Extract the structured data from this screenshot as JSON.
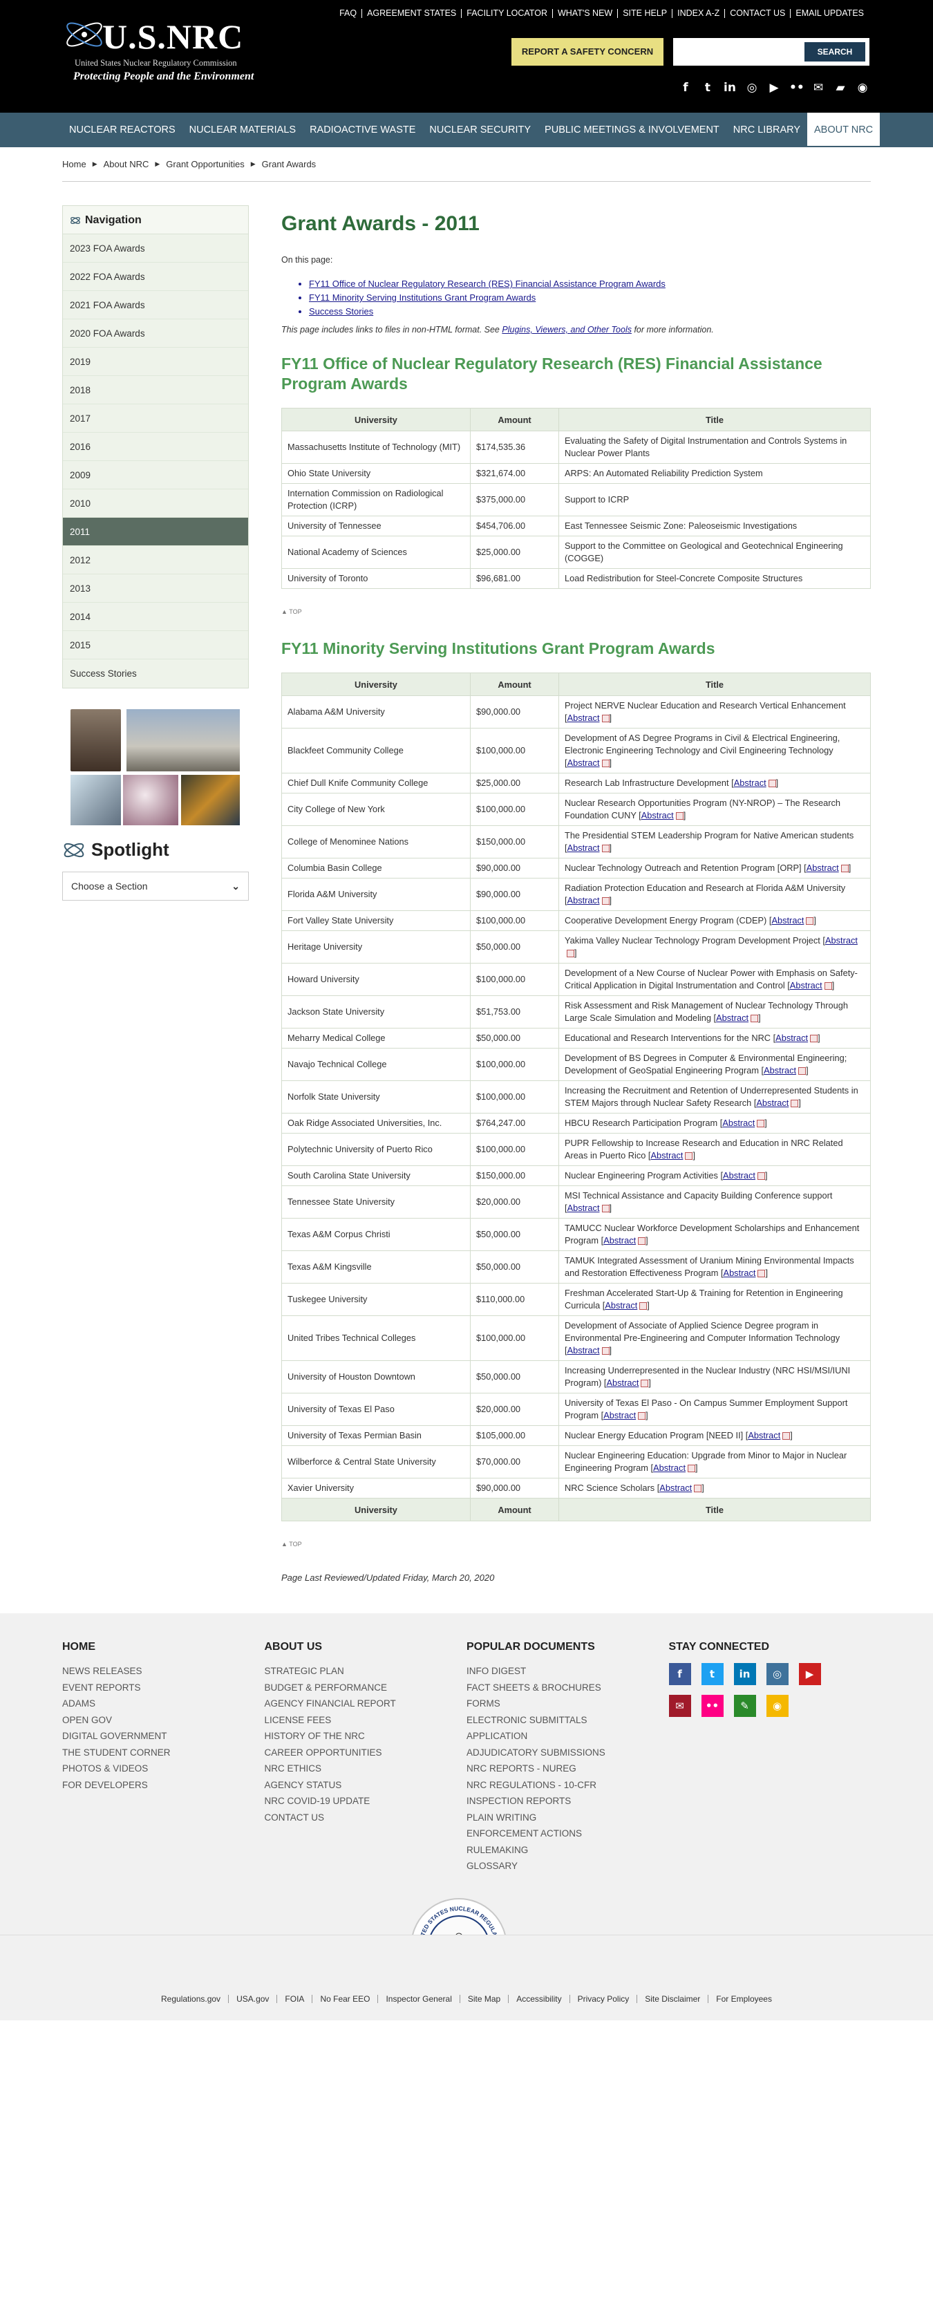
{
  "header": {
    "logo_title": "U.S.NRC",
    "logo_subtitle": "United States Nuclear Regulatory Commission",
    "logo_tagline": "Protecting People and the Environment",
    "utility_links": [
      "FAQ",
      "AGREEMENT STATES",
      "FACILITY LOCATOR",
      "WHAT'S NEW",
      "SITE HELP",
      "INDEX A-Z",
      "CONTACT US",
      "EMAIL UPDATES"
    ],
    "safety_button": "REPORT A SAFETY CONCERN",
    "search_placeholder": "",
    "search_button": "SEARCH"
  },
  "nav": [
    "NUCLEAR REACTORS",
    "NUCLEAR MATERIALS",
    "RADIOACTIVE WASTE",
    "NUCLEAR SECURITY",
    "PUBLIC MEETINGS & INVOLVEMENT",
    "NRC LIBRARY",
    "ABOUT NRC"
  ],
  "breadcrumb": [
    "Home",
    "About NRC",
    "Grant Opportunities",
    "Grant Awards"
  ],
  "sidebar": {
    "title": "Navigation",
    "items": [
      "2023 FOA Awards",
      "2022 FOA Awards",
      "2021 FOA Awards",
      "2020 FOA Awards",
      "2019",
      "2018",
      "2017",
      "2016",
      "2009",
      "2010",
      "2011",
      "2012",
      "2013",
      "2014",
      "2015",
      "Success Stories"
    ],
    "spotlight": "Spotlight",
    "section_select": "Choose a Section"
  },
  "page": {
    "title": "Grant Awards - 2011",
    "on_this_page": "On this page:",
    "toc": [
      "FY11 Office of Nuclear Regulatory Research (RES) Financial Assistance Program Awards",
      "FY11 Minority Serving Institutions Grant Program Awards",
      "Success Stories"
    ],
    "note_prefix": "This page includes links to files in non-HTML format. See ",
    "note_link": "Plugins, Viewers, and Other Tools",
    "note_suffix": " for more information.",
    "top_label": "TOP",
    "abstract_label": "Abstract",
    "reviewed": "Page Last Reviewed/Updated Friday, March 20, 2020"
  },
  "res_table": {
    "heading": "FY11 Office of Nuclear Regulatory Research (RES) Financial Assistance Program Awards",
    "columns": [
      "University",
      "Amount",
      "Title"
    ],
    "rows": [
      [
        "Massachusetts Institute of Technology (MIT)",
        "$174,535.36",
        "Evaluating the Safety of Digital Instrumentation and Controls Systems in Nuclear Power Plants"
      ],
      [
        "Ohio State University",
        "$321,674.00",
        "ARPS: An Automated Reliability Prediction System"
      ],
      [
        "Internation Commission on Radiological Protection (ICRP)",
        "$375,000.00",
        "Support to ICRP"
      ],
      [
        "University of Tennessee",
        "$454,706.00",
        "East Tennessee Seismic Zone: Paleoseismic Investigations"
      ],
      [
        "National Academy of Sciences",
        "$25,000.00",
        "Support to the Committee on Geological and Geotechnical Engineering (COGGE)"
      ],
      [
        "University of Toronto",
        "$96,681.00",
        "Load Redistribution for Steel-Concrete Composite Structures"
      ]
    ]
  },
  "msi_table": {
    "heading": "FY11 Minority Serving Institutions Grant Program Awards",
    "columns": [
      "University",
      "Amount",
      "Title"
    ],
    "rows": [
      [
        "Alabama A&M University",
        "$90,000.00",
        "Project NERVE Nuclear Education and Research Vertical Enhancement"
      ],
      [
        "Blackfeet Community College",
        "$100,000.00",
        "Development of AS Degree Programs in Civil & Electrical Engineering, Electronic Engineering Technology and Civil Engineering Technology"
      ],
      [
        "Chief Dull Knife Community College",
        "$25,000.00",
        "Research Lab Infrastructure Development"
      ],
      [
        "City College of New York",
        "$100,000.00",
        "Nuclear Research Opportunities Program (NY-NROP) – The Research Foundation CUNY"
      ],
      [
        "College of Menominee Nations",
        "$150,000.00",
        "The Presidential STEM Leadership Program for Native American students"
      ],
      [
        "Columbia Basin College",
        "$90,000.00",
        "Nuclear Technology Outreach and Retention Program [ORP]"
      ],
      [
        "Florida A&M University",
        "$90,000.00",
        "Radiation Protection Education and Research at Florida A&M University"
      ],
      [
        "Fort Valley State University",
        "$100,000.00",
        "Cooperative Development Energy Program (CDEP)"
      ],
      [
        "Heritage University",
        "$50,000.00",
        "Yakima Valley Nuclear Technology Program Development Project"
      ],
      [
        "Howard University",
        "$100,000.00",
        "Development of a New Course of Nuclear Power with Emphasis on Safety-Critical Application in Digital Instrumentation and Control"
      ],
      [
        "Jackson State University",
        "$51,753.00",
        "Risk Assessment and Risk Management of Nuclear Technology Through Large Scale Simulation and Modeling"
      ],
      [
        "Meharry Medical College",
        "$50,000.00",
        "Educational and Research Interventions for the NRC"
      ],
      [
        "Navajo Technical College",
        "$100,000.00",
        "Development of BS Degrees in Computer & Environmental Engineering; Development of GeoSpatial Engineering Program"
      ],
      [
        "Norfolk State University",
        "$100,000.00",
        "Increasing the Recruitment and Retention of Underrepresented Students in STEM Majors through Nuclear Safety Research"
      ],
      [
        "Oak Ridge Associated Universities, Inc.",
        "$764,247.00",
        "HBCU Research Participation Program"
      ],
      [
        "Polytechnic University of Puerto Rico",
        "$100,000.00",
        "PUPR Fellowship to Increase Research and Education in NRC Related Areas in Puerto Rico"
      ],
      [
        "South Carolina State University",
        "$150,000.00",
        "Nuclear Engineering Program Activities"
      ],
      [
        "Tennessee State University",
        "$20,000.00",
        "MSI Technical Assistance and Capacity Building Conference support"
      ],
      [
        "Texas A&M Corpus Christi",
        "$50,000.00",
        "TAMUCC Nuclear Workforce Development Scholarships and Enhancement Program"
      ],
      [
        "Texas A&M Kingsville",
        "$50,000.00",
        "TAMUK Integrated Assessment of Uranium Mining Environmental Impacts and Restoration Effectiveness Program"
      ],
      [
        "Tuskegee University",
        "$110,000.00",
        "Freshman Accelerated Start-Up & Training for Retention in Engineering Curricula"
      ],
      [
        "United Tribes Technical Colleges",
        "$100,000.00",
        "Development of Associate of Applied Science Degree program in Environmental Pre-Engineering and Computer Information Technology"
      ],
      [
        "University of Houston Downtown",
        "$50,000.00",
        "Increasing Underrepresented in the Nuclear Industry (NRC HSI/MSI/IUNI Program)"
      ],
      [
        "University of Texas El Paso",
        "$20,000.00",
        "University of Texas El Paso - On Campus Summer Employment Support Program"
      ],
      [
        "University of Texas Permian Basin",
        "$105,000.00",
        "Nuclear Energy Education Program [NEED II]"
      ],
      [
        "Wilberforce & Central State University",
        "$70,000.00",
        "Nuclear Engineering Education: Upgrade from Minor to Major in Nuclear Engineering Program"
      ],
      [
        "Xavier University",
        "$90,000.00",
        "NRC Science Scholars"
      ]
    ],
    "footer_columns": [
      "University",
      "Amount",
      "Title"
    ]
  },
  "footer": {
    "home": {
      "title": "HOME",
      "links": [
        "NEWS RELEASES",
        "EVENT REPORTS",
        "ADAMS",
        "OPEN GOV",
        "DIGITAL GOVERNMENT",
        "THE STUDENT CORNER",
        "PHOTOS & VIDEOS",
        "FOR DEVELOPERS"
      ]
    },
    "about": {
      "title": "ABOUT US",
      "links": [
        "STRATEGIC PLAN",
        "BUDGET & PERFORMANCE",
        "AGENCY FINANCIAL REPORT",
        "LICENSE FEES",
        "HISTORY OF THE NRC",
        "CAREER OPPORTUNITIES",
        "NRC ETHICS",
        "AGENCY STATUS",
        "NRC COVID-19 UPDATE",
        "CONTACT US"
      ]
    },
    "popular": {
      "title": "POPULAR DOCUMENTS",
      "links": [
        "INFO DIGEST",
        "FACT SHEETS & BROCHURES",
        "FORMS",
        "ELECTRONIC SUBMITTALS",
        "APPLICATION",
        "ADJUDICATORY SUBMISSIONS",
        "NRC REPORTS - NUREG",
        "NRC REGULATIONS - 10-CFR",
        "INSPECTION REPORTS",
        "PLAIN WRITING",
        "ENFORCEMENT ACTIONS",
        "RULEMAKING",
        "GLOSSARY"
      ]
    },
    "stay": {
      "title": "STAY CONNECTED"
    },
    "social_icons": [
      {
        "name": "facebook-icon",
        "glyph": "f",
        "color": "#3b5998"
      },
      {
        "name": "twitter-icon",
        "glyph": "t",
        "color": "#1da1f2"
      },
      {
        "name": "linkedin-icon",
        "glyph": "in",
        "color": "#0077b5"
      },
      {
        "name": "instagram-icon",
        "glyph": "◎",
        "color": "#3f729b"
      },
      {
        "name": "youtube-icon",
        "glyph": "▶",
        "color": "#cd201f"
      },
      {
        "name": "blog-icon",
        "glyph": "✉",
        "color": "#a01a2a"
      },
      {
        "name": "flickr-icon",
        "glyph": "••",
        "color": "#ff0084"
      },
      {
        "name": "edit-icon",
        "glyph": "✎",
        "color": "#2a8a2a"
      },
      {
        "name": "rss-icon",
        "glyph": "◉",
        "color": "#f5b800"
      }
    ],
    "bottom_links": [
      "Regulations.gov",
      "USA.gov",
      "FOIA",
      "No Fear EEO",
      "Inspector General",
      "Site Map",
      "Accessibility",
      "Privacy Policy",
      "Site Disclaimer",
      "For Employees"
    ],
    "seal_text": "UNITED STATES NUCLEAR REGULATORY COMMISSION"
  }
}
